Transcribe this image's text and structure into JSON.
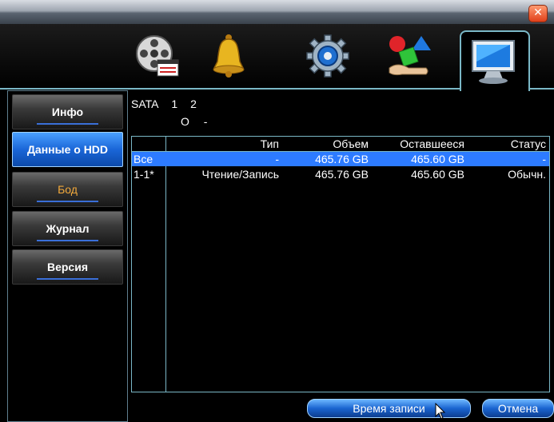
{
  "window": {
    "close_label": "✕"
  },
  "tabs": [
    {
      "icon": "film-reel-icon"
    },
    {
      "icon": "bell-icon"
    },
    {
      "icon": "gear-icon"
    },
    {
      "icon": "shapes-icon"
    },
    {
      "icon": "monitor-icon",
      "active": true
    }
  ],
  "sidebar": {
    "items": [
      {
        "label": "Инфо"
      },
      {
        "label": "Данные о HDD"
      },
      {
        "label": "Бод"
      },
      {
        "label": "Журнал"
      },
      {
        "label": "Версия"
      }
    ]
  },
  "hdd": {
    "sata_label": "SATA",
    "ports": [
      "1",
      "2"
    ],
    "port_status": [
      "O",
      "-"
    ],
    "headers": {
      "type": "Тип",
      "volume": "Объем",
      "remaining": "Оставшееся",
      "status": "Статус"
    },
    "rows": [
      {
        "id": "Все",
        "type": "-",
        "volume": "465.76 GB",
        "remaining": "465.60 GB",
        "status": "-"
      },
      {
        "id": "1-1*",
        "type": "Чтение/Запись",
        "volume": "465.76 GB",
        "remaining": "465.60 GB",
        "status": "Обычн."
      }
    ]
  },
  "buttons": {
    "record_time": "Время записи",
    "cancel": "Отмена"
  },
  "colors": {
    "selection": "#2d7bff",
    "border": "#7ab7c6",
    "highlight_text": "#f2a93b"
  }
}
